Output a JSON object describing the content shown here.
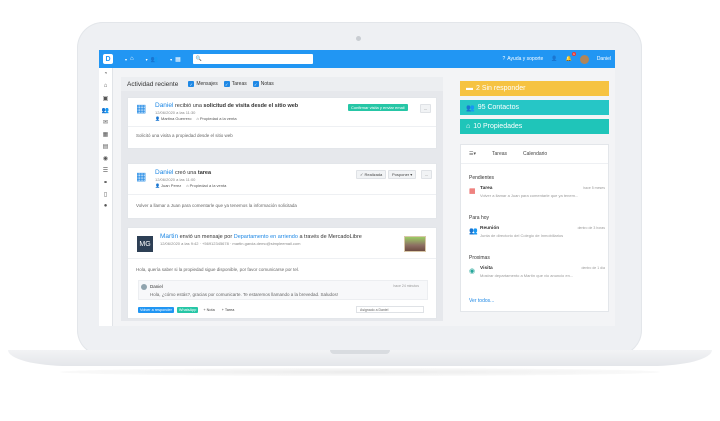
{
  "topbar": {
    "logo": "D",
    "nav": [
      {
        "icon": "home-icon",
        "glyph": "⌂"
      },
      {
        "icon": "users-icon",
        "glyph": "👥"
      },
      {
        "icon": "building-icon",
        "glyph": "▦"
      }
    ],
    "search_glyph": "🔍",
    "help_label": "Ayuda y soporte",
    "notif_count": "1",
    "user_name": "Daniel"
  },
  "sidebar": {
    "items": [
      {
        "name": "dashboard-icon",
        "glyph": "◔"
      },
      {
        "name": "home-icon",
        "glyph": "⌂"
      },
      {
        "name": "image-icon",
        "glyph": "▣"
      },
      {
        "name": "contacts-icon",
        "glyph": "👥"
      },
      {
        "name": "mail-icon",
        "glyph": "✉"
      },
      {
        "name": "calendar-icon",
        "glyph": "▦"
      },
      {
        "name": "chart-icon",
        "glyph": "▤"
      },
      {
        "name": "globe-icon",
        "glyph": "◉"
      },
      {
        "name": "list-icon",
        "glyph": "☰"
      },
      {
        "name": "link-icon",
        "glyph": "⚭"
      },
      {
        "name": "document-icon",
        "glyph": "▯"
      },
      {
        "name": "user-icon",
        "glyph": "●"
      }
    ]
  },
  "activity": {
    "title": "Actividad reciente",
    "filters": [
      "Mensajes",
      "Tareas",
      "Notas"
    ],
    "cards": [
      {
        "who": "Daniel",
        "text_plain": " recibió una ",
        "text_bold": "solicitud de visita desde el sitio web",
        "date": "12/06/2020 a las 11:30",
        "tag_user": "Martina Guerrero",
        "tag_prop": "Propiedad a la venta",
        "body": "Solicitó una visita a propiedad desde el sitio web",
        "action": "Confirmar visita y enviar email",
        "more": "..."
      },
      {
        "who": "Daniel",
        "text_plain": " creó una ",
        "text_bold": "tarea",
        "date": "12/06/2020 a las 11:00",
        "tag_user": "Juan Perez",
        "tag_prop": "Propiedad a la venta",
        "body": "Volver a llamar a Juan para comentarle que ya tenemos la información solicitada",
        "done": "Realizada",
        "postpone": "Posponer ▾",
        "more": "..."
      },
      {
        "who": "Martin",
        "text_plain": " envió un mensaje por ",
        "link": "Departamento en arriendo",
        "text_after": " a través de MercadoLibre",
        "avatar": "MG",
        "date": "12/06/2020 a las 9:42 · +56912345678 · martin.garcia.demo@simpleemail.com",
        "body": "Hola, quería saber si la propiedad sigue disponible, por favor comunicarse por tel.",
        "reply_name": "Daniel",
        "reply_time": "hace 24 minutos",
        "reply_body": "Hola, ¿cómo estás?, gracias por comunicarte. Te estaremos llamando a la brevedad. Saludos!",
        "btn_reply": "Volver a responder",
        "btn_whatsapp": "WhatsApp",
        "btn_note": "+ Nota",
        "btn_task": "+ Tarea",
        "assign": "Asignado a Daniel"
      }
    ]
  },
  "stats": [
    {
      "icon": "inbox-icon",
      "glyph": "▬",
      "label": "2 Sin responder"
    },
    {
      "icon": "contacts-icon",
      "glyph": "👥",
      "label": "95 Contactos"
    },
    {
      "icon": "home-icon",
      "glyph": "⌂",
      "label": "10 Propiedades"
    }
  ],
  "tasks": {
    "tabs": [
      "Tareas",
      "Calendario"
    ],
    "sections": {
      "pending": "Pendientes",
      "today": "Para hoy",
      "next": "Proximas"
    },
    "items": [
      {
        "icon": "calendar-icon",
        "glyph": "▦",
        "color": "#e53935",
        "name": "Tarea",
        "when": "hace 5 meses",
        "desc": "Volver a llamar a Juan para comentarle que ya tenem..."
      },
      {
        "icon": "people-icon",
        "glyph": "👥",
        "color": "#1e88e5",
        "name": "Reunión",
        "when": "dentro de 3 horas",
        "desc": "Junta de directorio del Colegio de Inmobiliarios"
      },
      {
        "icon": "globe-icon",
        "glyph": "◉",
        "color": "#26a69a",
        "name": "Visita",
        "when": "dentro de 1 día",
        "desc": "Mostrar departamento a Martín que vio anuncio en..."
      }
    ],
    "see_all": "Ver todos..."
  }
}
